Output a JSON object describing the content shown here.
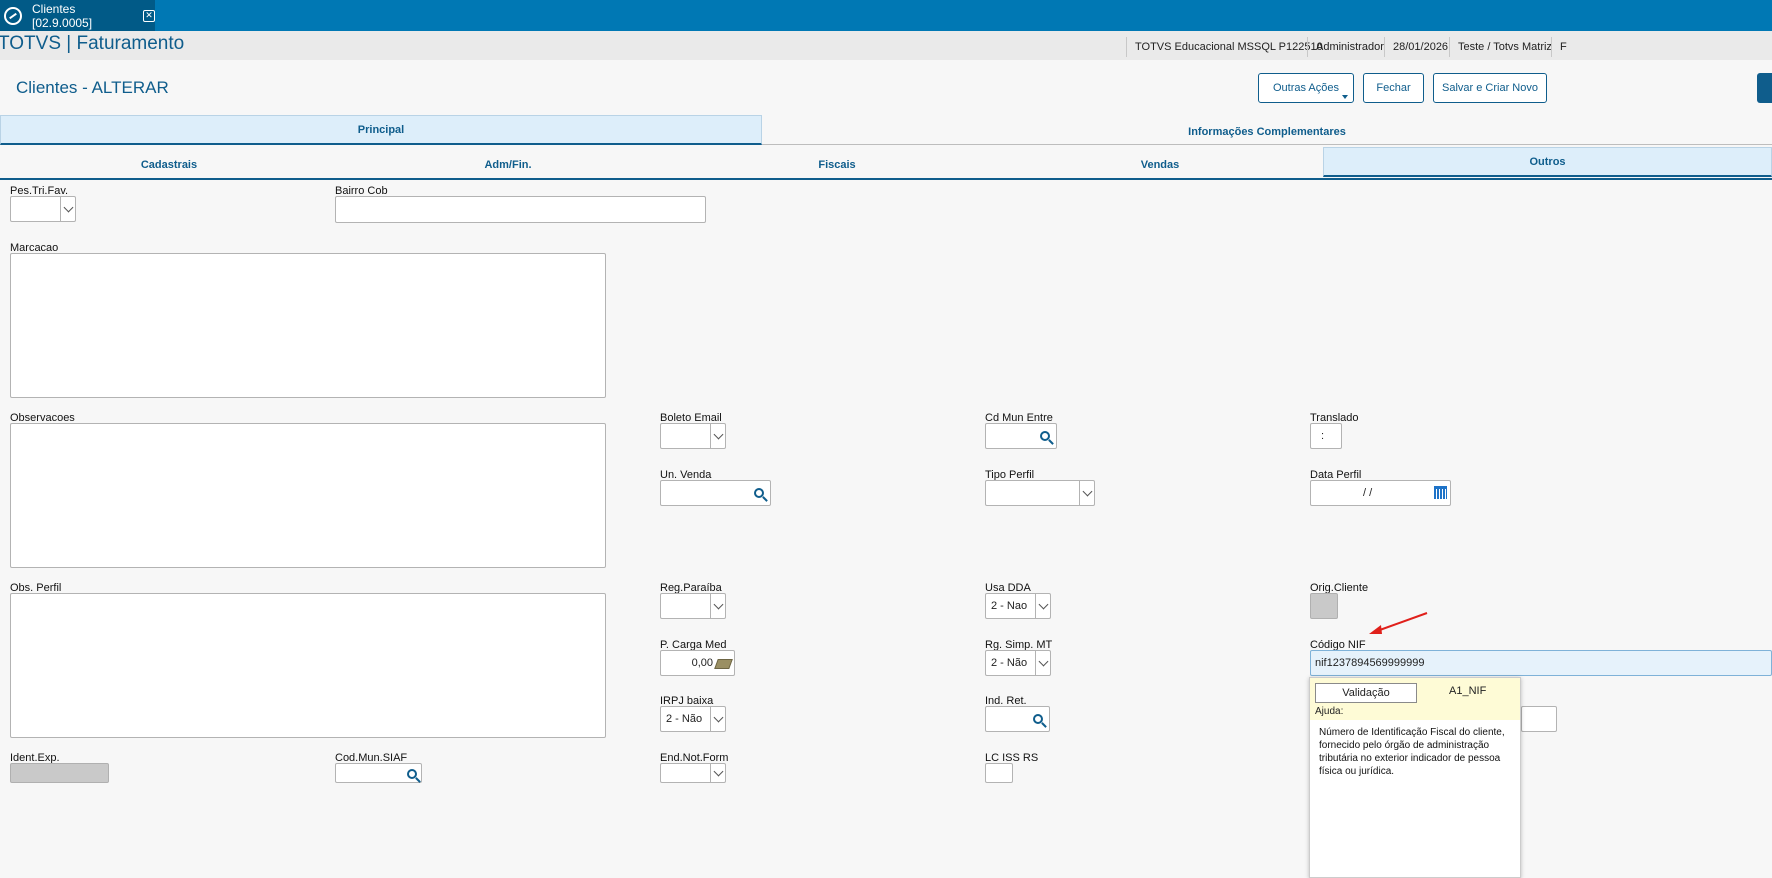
{
  "tab": {
    "title": "Clientes [02.9.0005]",
    "close_glyph": "✕"
  },
  "header": {
    "app_title": "TOTVS | Faturamento",
    "environment": "TOTVS Educacional MSSQL P122510",
    "user": "Administrador",
    "date": "28/01/2026",
    "company": "Teste / Totvs Matriz",
    "extra": "F"
  },
  "page": {
    "title": "Clientes - ALTERAR"
  },
  "actions": {
    "outras_acoes": "Outras Ações",
    "fechar": "Fechar",
    "salvar_criar": "Salvar e Criar Novo"
  },
  "main_tabs": {
    "principal": "Principal",
    "info_complementares": "Informações Complementares"
  },
  "sub_tabs": {
    "cadastrais": "Cadastrais",
    "adm_fin": "Adm/Fin.",
    "fiscais": "Fiscais",
    "vendas": "Vendas",
    "outros": "Outros"
  },
  "form": {
    "pes_tri_fav": {
      "label": "Pes.Tri.Fav.",
      "value": ""
    },
    "bairro_cob": {
      "label": "Bairro Cob",
      "value": ""
    },
    "marcacao": {
      "label": "Marcacao"
    },
    "observacoes": {
      "label": "Observacoes"
    },
    "obs_perfil": {
      "label": "Obs. Perfil"
    },
    "ident_exp": {
      "label": "Ident.Exp."
    },
    "cod_mun_siaf": {
      "label": "Cod.Mun.SIAF"
    },
    "boleto_email": {
      "label": "Boleto Email",
      "value": ""
    },
    "un_venda": {
      "label": "Un. Venda"
    },
    "reg_paraiba": {
      "label": "Reg.Paraíba",
      "value": ""
    },
    "p_carga_med": {
      "label": "P. Carga Med",
      "value": "0,00"
    },
    "irpj_baixa": {
      "label": "IRPJ baixa",
      "value": "2 - Não"
    },
    "end_not_form": {
      "label": "End.Not.Form"
    },
    "cd_mun_entre": {
      "label": "Cd Mun Entre"
    },
    "tipo_perfil": {
      "label": "Tipo Perfil",
      "value": ""
    },
    "usa_dda": {
      "label": "Usa DDA",
      "value": "2 - Nao"
    },
    "rg_simp_mt": {
      "label": "Rg. Simp. MT",
      "value": "2 - Não"
    },
    "ind_ret": {
      "label": "Ind. Ret."
    },
    "lc_iss_rs": {
      "label": "LC ISS RS"
    },
    "translado": {
      "label": "Translado",
      "value": ":"
    },
    "data_perfil": {
      "label": "Data Perfil",
      "value": "/ /"
    },
    "orig_cliente": {
      "label": "Orig.Cliente"
    },
    "codigo_nif": {
      "label": "Código NIF",
      "value": "nif1237894569999999"
    }
  },
  "tooltip": {
    "validacao": "Validação",
    "field": "A1_NIF",
    "ajuda": "Ajuda:",
    "text": "Número de Identificação Fiscal do cliente, fornecido pelo órgão de administração tributária no exterior indicador de pessoa física ou jurídica."
  },
  "colors": {
    "brand": "#0078b4",
    "brand_dark": "#015a87",
    "accent_text": "#0f5d8c",
    "annotation": "#e0201b"
  }
}
